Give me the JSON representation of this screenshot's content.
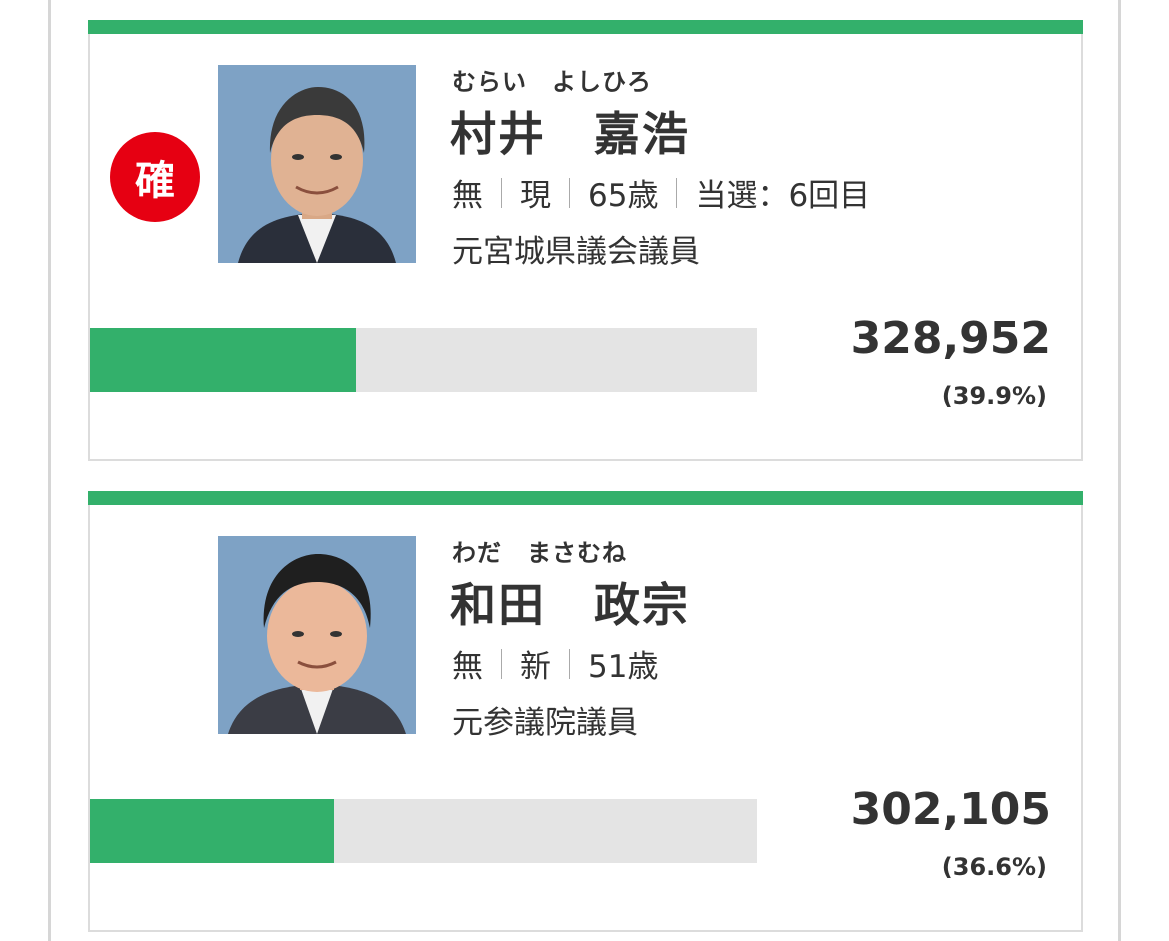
{
  "colors": {
    "accent_green": "#33b06b",
    "elected_badge_red": "#e60012",
    "bar_track_gray": "#e4e4e4",
    "photo_background": "#7ea2c5"
  },
  "candidates": [
    {
      "elected_badge": "確",
      "kana": "むらい　よしひろ",
      "name": "村井　嘉浩",
      "party": "無",
      "status": "現",
      "age": "65歳",
      "term": "当選：6回目",
      "career": "元宮城県議会議員",
      "votes": "328,952",
      "percent_label": "(39.9%)",
      "percent": 39.9,
      "photo_icon": "candidate-portrait"
    },
    {
      "kana": "わだ　まさむね",
      "name": "和田　政宗",
      "party": "無",
      "status": "新",
      "age": "51歳",
      "career": "元参議院議員",
      "votes": "302,105",
      "percent_label": "(36.6%)",
      "percent": 36.6,
      "photo_icon": "candidate-portrait"
    }
  ]
}
